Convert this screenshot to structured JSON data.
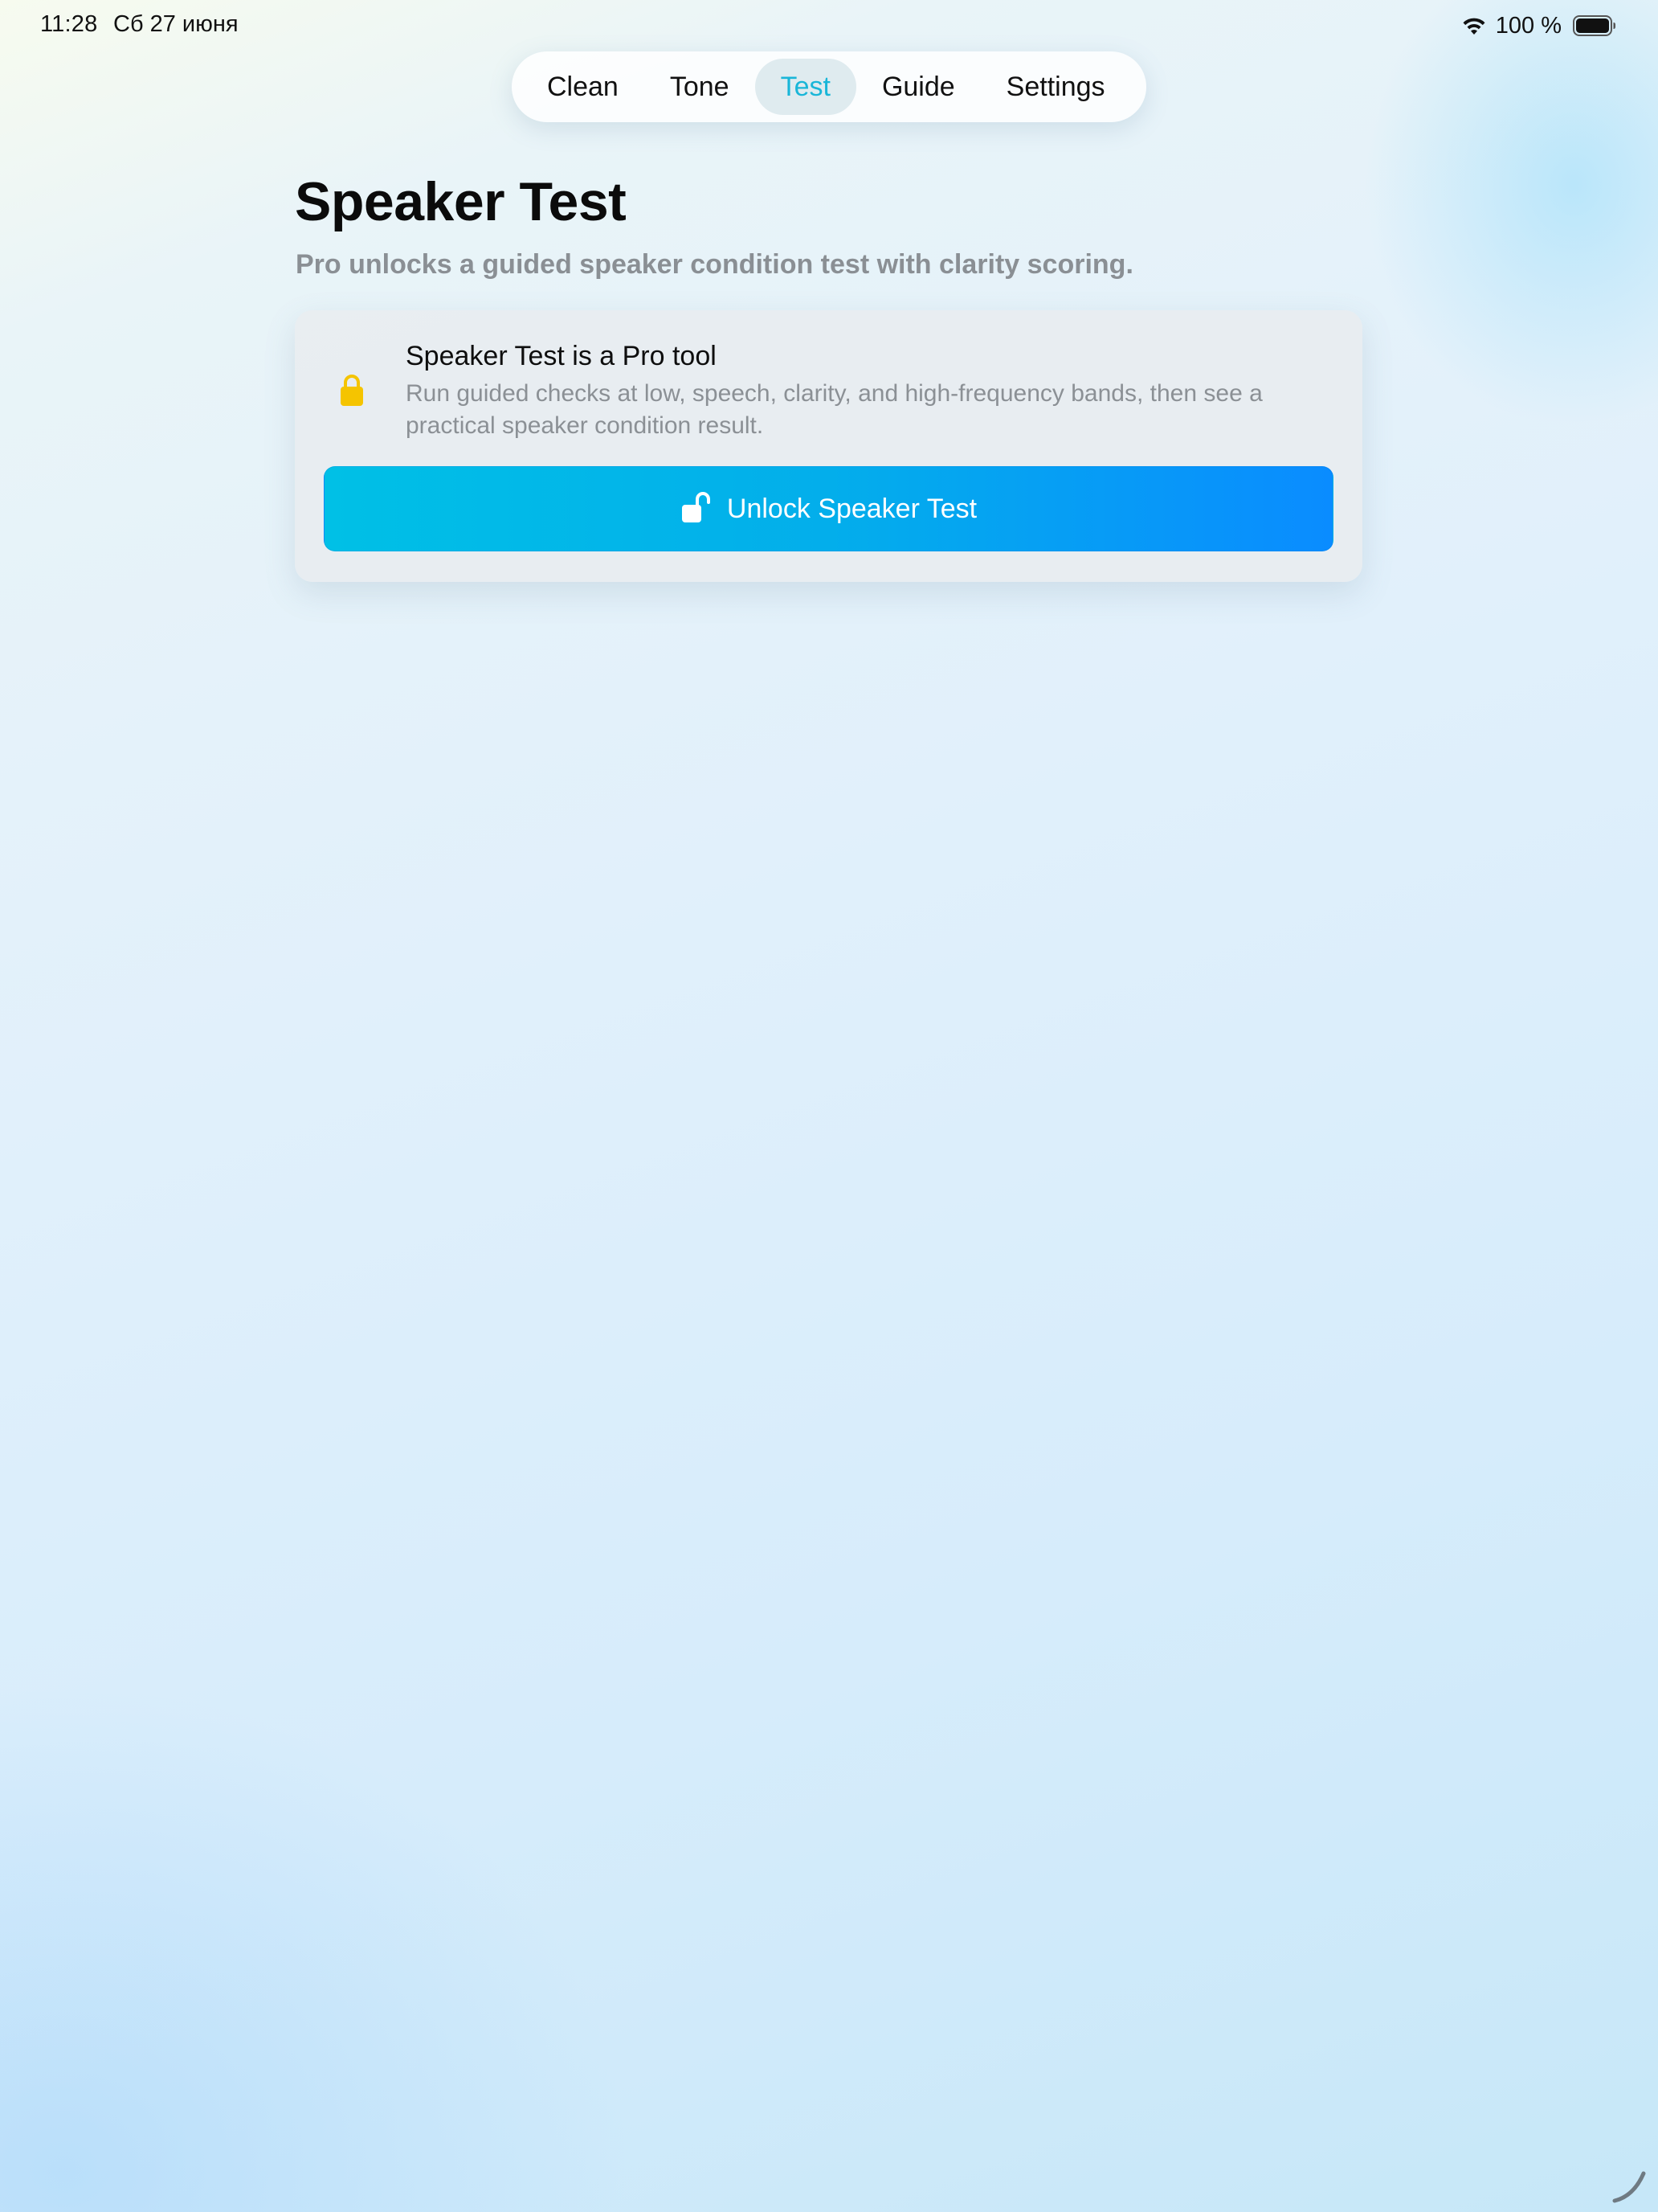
{
  "status_bar": {
    "time": "11:28",
    "date": "Сб 27 июня",
    "battery_percent": "100 %",
    "icons": [
      "wifi-icon",
      "battery-icon"
    ]
  },
  "tabs": [
    {
      "label": "Clean",
      "active": false
    },
    {
      "label": "Tone",
      "active": false
    },
    {
      "label": "Test",
      "active": true
    },
    {
      "label": "Guide",
      "active": false
    },
    {
      "label": "Settings",
      "active": false
    }
  ],
  "header": {
    "title": "Speaker Test",
    "subtitle": "Pro unlocks a guided speaker condition test with clarity scoring."
  },
  "pro_card": {
    "icon": "lock-icon",
    "title": "Speaker Test is a Pro tool",
    "description": "Run guided checks at low, speech, clarity, and high-frequency bands, then see a practical speaker condition result.",
    "button": {
      "icon": "unlock-icon",
      "label": "Unlock Speaker Test"
    }
  },
  "colors": {
    "accent": "#19b6d8",
    "button_gradient_start": "#00c0e6",
    "button_gradient_end": "#0a8cff",
    "lock": "#f5c400",
    "secondary_text": "#8a8f94"
  }
}
